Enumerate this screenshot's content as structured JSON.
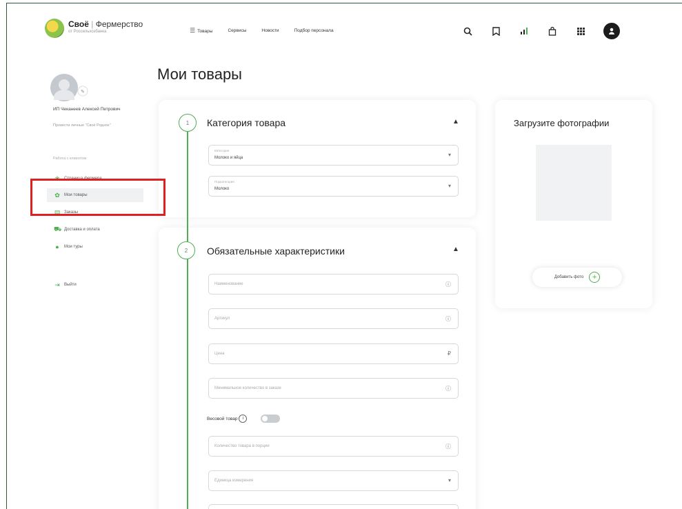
{
  "header": {
    "brand_name": "Своё",
    "brand_separator": "|",
    "brand_second": "Фермерство",
    "brand_sub": "от Россельхозбанка",
    "nav": [
      "Товары",
      "Сервисы",
      "Новости",
      "Подбор персонала"
    ],
    "icons": [
      "search-icon",
      "bookmark-icon",
      "stats-icon",
      "cart-icon",
      "grid-icon",
      "user-icon"
    ]
  },
  "sidebar": {
    "user_name": "ИП Чеканеев Алексей Петрович",
    "user_farm": "Провести личные \"Своё Родное\"",
    "section_label": "Работа с клиентом",
    "items": [
      {
        "label": "Страница фермера",
        "icon": "leaf-icon"
      },
      {
        "label": "Мои товары",
        "icon": "sprout-icon"
      },
      {
        "label": "Заказы",
        "icon": "orders-icon"
      },
      {
        "label": "Доставка и оплата",
        "icon": "delivery-icon"
      },
      {
        "label": "Мои туры",
        "icon": "location-icon"
      },
      {
        "label": "Выйти",
        "icon": "logout-icon"
      }
    ]
  },
  "main": {
    "title": "Мои товары",
    "section1": {
      "step": "1",
      "title": "Категория товара",
      "fields": [
        {
          "label": "Категория",
          "value": "Молоко и яйца"
        },
        {
          "label": "Подкатегория",
          "value": "Молоко"
        }
      ]
    },
    "section2": {
      "step": "2",
      "title": "Обязательные характеристики",
      "fields": [
        {
          "placeholder": "Наименование",
          "tail": "ⓘ"
        },
        {
          "placeholder": "Артикул",
          "tail": "ⓘ"
        },
        {
          "placeholder": "Цена",
          "tail": "₽"
        },
        {
          "placeholder": "Минимальное количество в заказе",
          "tail": "ⓘ"
        },
        {
          "placeholder": "Количество товара в порции",
          "tail": "ⓘ"
        },
        {
          "placeholder": "Единица измерения",
          "tail": "▾"
        }
      ],
      "weight_label": "Весовой товар",
      "weight_info": "i",
      "weight_on": false
    },
    "photos": {
      "title": "Загрузите фотографии",
      "add_label": "Добавить фото",
      "add_symbol": "+"
    }
  },
  "colors": {
    "accent": "#4caf50",
    "highlight": "#e02020",
    "frame": "#2e5a3a"
  }
}
